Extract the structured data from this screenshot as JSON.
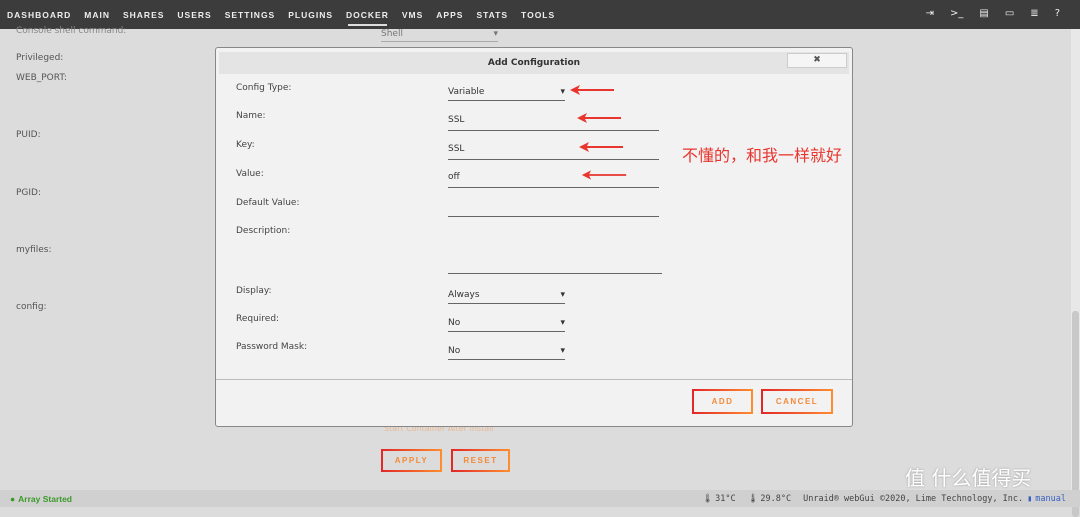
{
  "nav": {
    "items": [
      "DASHBOARD",
      "MAIN",
      "SHARES",
      "USERS",
      "SETTINGS",
      "PLUGINS",
      "DOCKER",
      "VMS",
      "APPS",
      "STATS",
      "TOOLS"
    ],
    "active": "DOCKER"
  },
  "background": {
    "labels": [
      "Console shell command:",
      "Privileged:",
      "WEB_PORT:",
      "PUID:",
      "PGID:",
      "myfiles:",
      "config:"
    ],
    "shell_value": "Shell",
    "start_container_text": "Start Container After Install",
    "apply": "APPLY",
    "reset": "RESET"
  },
  "modal": {
    "title": "Add Configuration",
    "close": "✖",
    "rows": [
      {
        "label": "Config Type:",
        "value": "Variable",
        "type": "select"
      },
      {
        "label": "Name:",
        "value": "SSL",
        "type": "input"
      },
      {
        "label": "Key:",
        "value": "SSL",
        "type": "input"
      },
      {
        "label": "Value:",
        "value": "off",
        "type": "input"
      },
      {
        "label": "Default Value:",
        "value": "",
        "type": "input"
      },
      {
        "label": "Description:",
        "value": "",
        "type": "textarea"
      },
      {
        "label": "Display:",
        "value": "Always",
        "type": "select"
      },
      {
        "label": "Required:",
        "value": "No",
        "type": "select"
      },
      {
        "label": "Password Mask:",
        "value": "No",
        "type": "select"
      }
    ],
    "add": "ADD",
    "cancel": "CANCEL"
  },
  "annotation": "不懂的，和我一样就好",
  "annotation_color": "#e8352e",
  "footer": {
    "status": "Array Started",
    "temp1": "31°C",
    "temp2": "29.8°C",
    "copyright": "Unraid® webGui ©2020, Lime Technology, Inc.",
    "manual": "manual"
  },
  "watermark": "值 什么值得买",
  "accent": "#f28a3a"
}
